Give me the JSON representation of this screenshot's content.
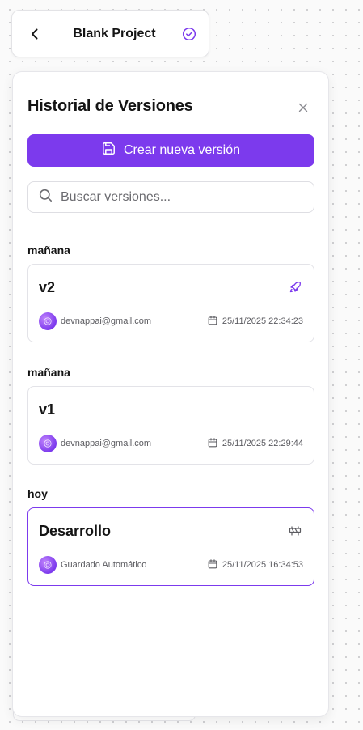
{
  "header": {
    "title": "Blank Project"
  },
  "panel": {
    "title": "Historial de Versiones",
    "create_label": "Crear nueva versión",
    "search_placeholder": "Buscar versiones..."
  },
  "groups": [
    {
      "label": "mañana",
      "version": {
        "name": "v2",
        "author": "devnappai@gmail.com",
        "date": "25/11/2025 22:34:23",
        "status_icon": "rocket-icon"
      }
    },
    {
      "label": "mañana",
      "version": {
        "name": "v1",
        "author": "devnappai@gmail.com",
        "date": "25/11/2025 22:29:44",
        "status_icon": "none"
      }
    },
    {
      "label": "hoy",
      "version": {
        "name": "Desarrollo",
        "author": "Guardado Automático",
        "date": "25/11/2025 16:34:53",
        "status_icon": "construction-icon"
      }
    }
  ],
  "colors": {
    "accent": "#7c3aed",
    "border": "#e3e3e8"
  }
}
